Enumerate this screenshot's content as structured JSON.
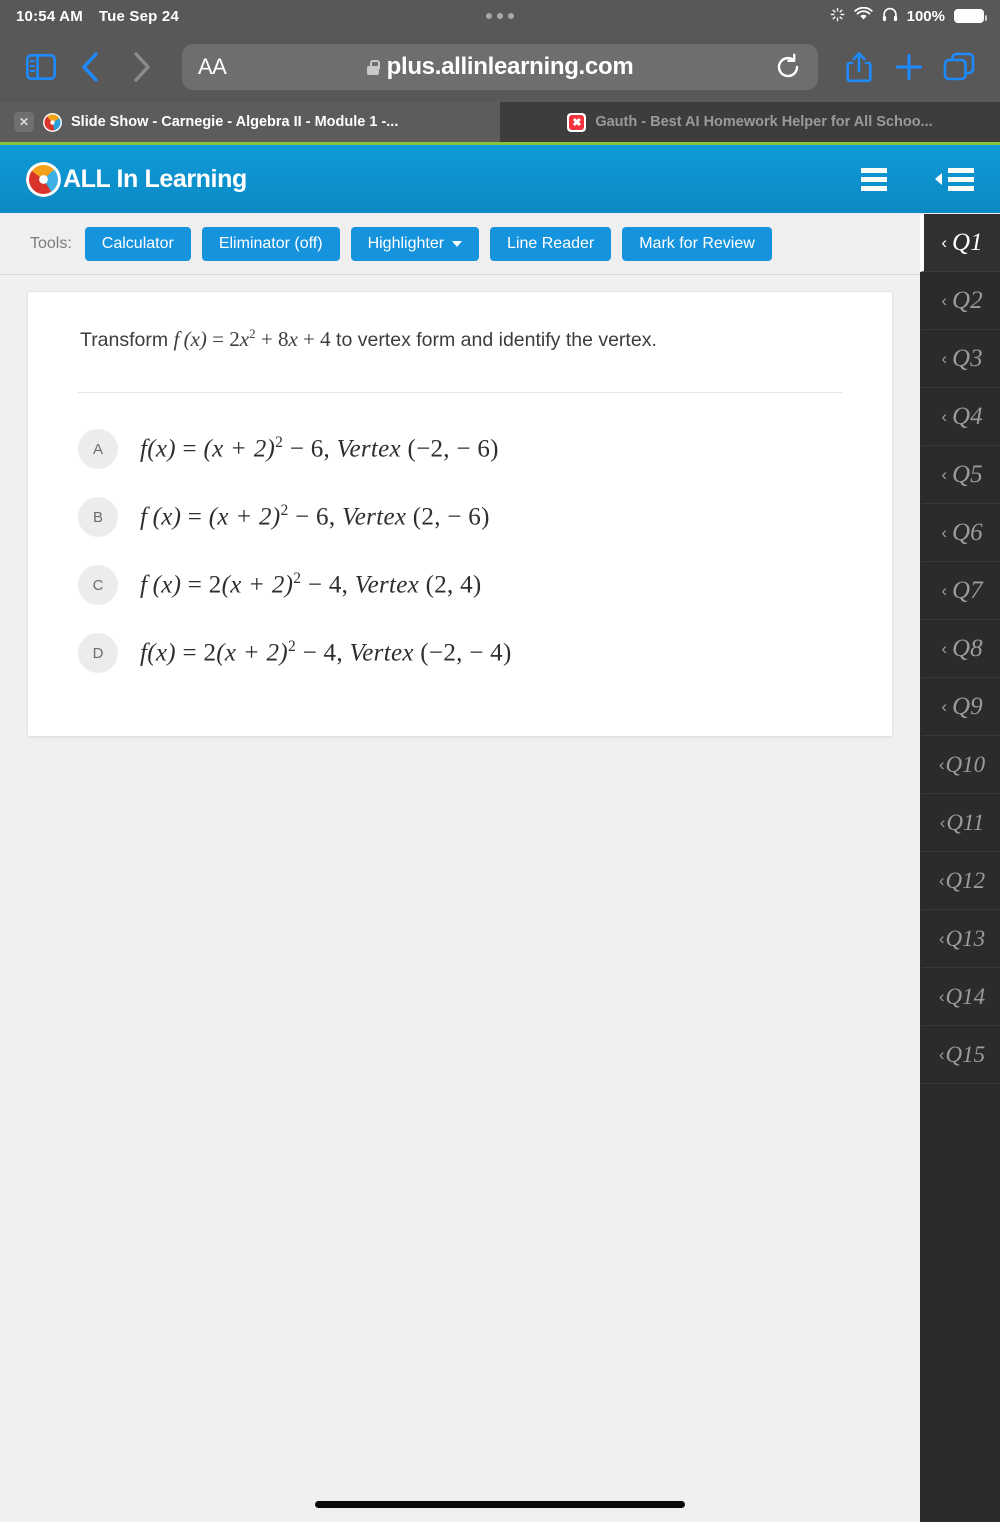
{
  "status_bar": {
    "time": "10:54 AM",
    "date": "Tue Sep 24",
    "battery_percent": "100%",
    "icons": [
      "activity-spinner-icon",
      "wifi-icon",
      "headphones-icon",
      "battery-icon"
    ]
  },
  "browser": {
    "back_icon": "chevron-left-icon",
    "forward_icon": "chevron-right-icon",
    "sidebar_icon": "sidebar-toggle-icon",
    "text_size_label": "AA",
    "url": "plus.allinlearning.com",
    "reload_icon": "reload-icon",
    "share_icon": "share-icon",
    "new_tab_icon": "plus-icon",
    "tabs_icon": "tab-overview-icon",
    "tabs": [
      {
        "label": "Slide Show - Carnegie - Algebra II - Module 1 -...",
        "active": true,
        "favicon": "all-in-learning-favicon"
      },
      {
        "label": "Gauth - Best AI Homework Helper for All Schoo...",
        "active": false,
        "favicon": "gauth-favicon"
      }
    ]
  },
  "app_header": {
    "brand": "ALL In Learning",
    "logo": "all-in-learning-logo",
    "menu_icon": "hamburger-menu-icon",
    "collapse_icon": "collapse-panel-icon",
    "accent_color": "#0f9ad8"
  },
  "tools_bar": {
    "label": "Tools:",
    "buttons": [
      {
        "label": "Calculator",
        "name": "calculator"
      },
      {
        "label": "Eliminator (off)",
        "name": "eliminator"
      },
      {
        "label": "Highlighter",
        "name": "highlighter",
        "has_caret": true
      },
      {
        "label": "Line Reader",
        "name": "line-reader"
      },
      {
        "label": "Mark for Review",
        "name": "mark-for-review"
      }
    ],
    "button_color": "#1693dd"
  },
  "question": {
    "prompt_prefix": "Transform ",
    "prompt_fn": "f",
    "prompt_arg": "(x)",
    "prompt_eq": "= 2",
    "prompt_var": "x",
    "prompt_exp": "2",
    "prompt_rest": "+ 8",
    "prompt_var2": "x",
    "prompt_tail": "+ 4",
    "prompt_suffix": " to vertex form and identify the vertex.",
    "full_text": "Transform f (x) = 2x² + 8x + 4 to vertex form and identify the vertex.",
    "choices": [
      {
        "letter": "A",
        "text": "f(x) = (x + 2)² − 6, Vertex (−2, − 6)",
        "fn": "f",
        "arg": "(x)",
        "eq": "=",
        "lead": "",
        "body": "(x + 2)",
        "exp": "2",
        "const": "− 6,",
        "vertex_word": "Vertex",
        "vertex": "(−2,  − 6)"
      },
      {
        "letter": "B",
        "text": "f (x) = (x + 2)² − 6, Vertex (2, − 6)",
        "fn": "f",
        "arg": "(x)",
        "eq": "=",
        "lead": "",
        "body": "(x + 2)",
        "exp": "2",
        "const": "− 6,",
        "vertex_word": "Vertex",
        "vertex": "(2,  − 6)"
      },
      {
        "letter": "C",
        "text": "f (x) = 2(x + 2)² − 4, Vertex (2, 4)",
        "fn": "f",
        "arg": "(x)",
        "eq": "=",
        "lead": "2",
        "body": "(x + 2)",
        "exp": "2",
        "const": "− 4,",
        "vertex_word": "Vertex",
        "vertex": "(2, 4)"
      },
      {
        "letter": "D",
        "text": "f(x) = 2(x + 2)² − 4, Vertex (−2, − 4)",
        "fn": "f",
        "arg": "(x)",
        "eq": "=",
        "lead": "2",
        "body": "(x + 2)",
        "exp": "2",
        "const": "− 4,",
        "vertex_word": "Vertex",
        "vertex": "(−2,  − 4)"
      }
    ]
  },
  "question_nav": {
    "chevron": "‹",
    "items": [
      {
        "label": "Q1",
        "active": true
      },
      {
        "label": "Q2",
        "active": false
      },
      {
        "label": "Q3",
        "active": false
      },
      {
        "label": "Q4",
        "active": false
      },
      {
        "label": "Q5",
        "active": false
      },
      {
        "label": "Q6",
        "active": false
      },
      {
        "label": "Q7",
        "active": false
      },
      {
        "label": "Q8",
        "active": false
      },
      {
        "label": "Q9",
        "active": false
      },
      {
        "label": "Q10",
        "active": false
      },
      {
        "label": "Q11",
        "active": false
      },
      {
        "label": "Q12",
        "active": false
      },
      {
        "label": "Q13",
        "active": false
      },
      {
        "label": "Q14",
        "active": false
      },
      {
        "label": "Q15",
        "active": false
      }
    ]
  }
}
